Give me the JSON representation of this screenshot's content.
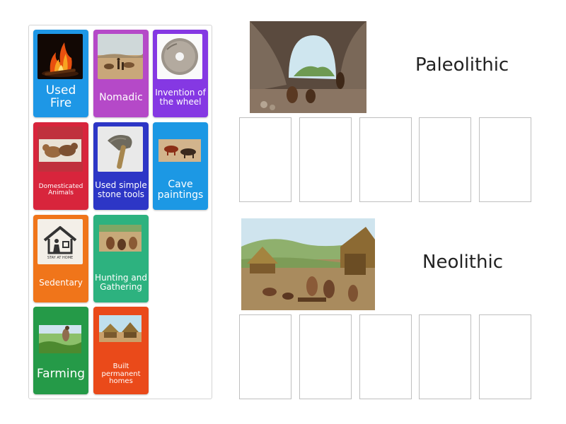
{
  "cards": [
    {
      "label": "Used Fire",
      "icon": "fire-icon",
      "color": "#1e97e6"
    },
    {
      "label": "Nomadic",
      "icon": "nomadic-icon",
      "color": "#b549c8"
    },
    {
      "label": "Invention of the wheel",
      "icon": "stone-wheel-icon",
      "color": "#8538e3"
    },
    {
      "label": "Domesticated Animals",
      "icon": "animals-icon",
      "color": "#d8253c"
    },
    {
      "label": "Used simple stone tools",
      "icon": "stone-tool-icon",
      "color": "#2d36c6"
    },
    {
      "label": "Cave paintings",
      "icon": "cave-painting-icon",
      "color": "#1c98e4"
    },
    {
      "label": "Sedentary",
      "icon": "house-icon",
      "color": "#f0751a",
      "icon_caption": "STAY AT HOME"
    },
    {
      "label": "Hunting and Gathering",
      "icon": "hunters-icon",
      "color": "#2db27f"
    },
    {
      "label": "Farming",
      "icon": "farmer-icon",
      "color": "#259a48"
    },
    {
      "label": "Built permanent homes",
      "icon": "huts-icon",
      "color": "#ea4a1a"
    }
  ],
  "groups": [
    {
      "title": "Paleolithic",
      "image": "cave-scene",
      "slot_count": 5
    },
    {
      "title": "Neolithic",
      "image": "village-scene",
      "slot_count": 5
    }
  ]
}
